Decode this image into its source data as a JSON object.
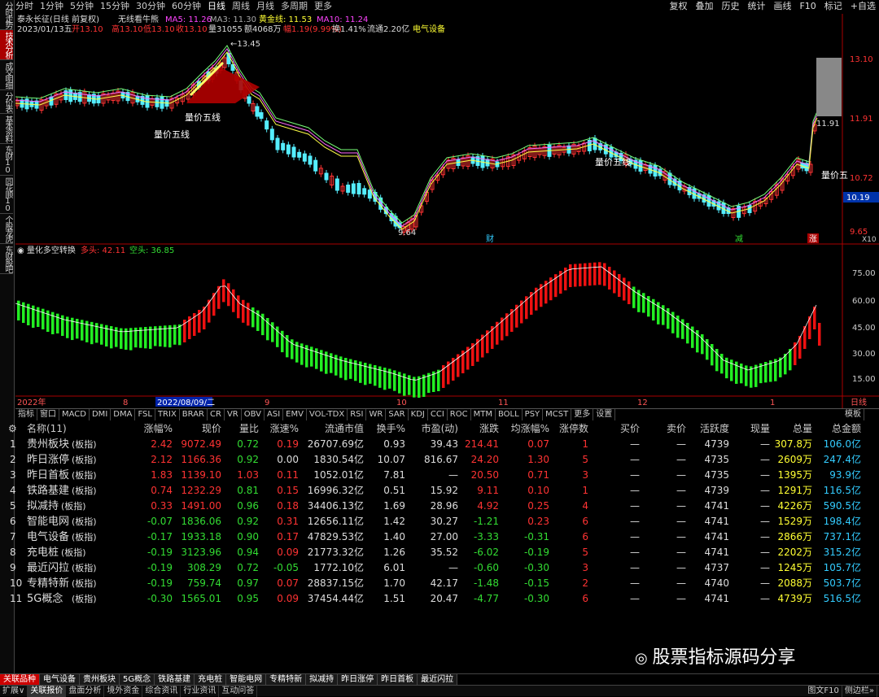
{
  "leftbar": [
    "分时走势",
    "技术分析",
    "成交明细",
    "分价表",
    "基本资料",
    "东财10",
    "同花顺10",
    "个股龙虎",
    "东财股吧"
  ],
  "toolbar": {
    "periods": [
      "分时",
      "1分钟",
      "5分钟",
      "15分钟",
      "30分钟",
      "60分钟",
      "日线",
      "周线",
      "月线",
      "多周期",
      "更多"
    ],
    "active": "日线",
    "right": [
      "复权",
      "叠加",
      "历史",
      "统计",
      "画线",
      "F10",
      "标记",
      "+自选"
    ]
  },
  "stock": {
    "title": "泰永长征(日线 前复权)",
    "indicator": "无线看牛熊",
    "ma5": "MA5: 11.26",
    "ma3": "MA3: 11.30",
    "gold": "黄金线: 11.53",
    "ma10": "MA10: 11.24",
    "info_date": "2023/01/13五",
    "info_open": "开13.10",
    "info_high": "高13.10",
    "info_low": "低13.10",
    "info_close": "收13.10",
    "info_vol": "量31055",
    "info_amt": "额4068万",
    "info_chg": "幅1.19(9.99%)",
    "info_turn": "换1.41%",
    "info_float": "流通2.20亿",
    "info_sector": "电气设备"
  },
  "price_axis": [
    "13.10",
    "11.91",
    "10.72",
    "9.65"
  ],
  "current_price": "10.19",
  "labels": {
    "high": "13.45",
    "low": "9.64",
    "lb1": "量价五线",
    "lb2": "量价五线",
    "lb3": "量价五线",
    "lb4": "量价五",
    "cur_hi": "11.91",
    "cai": "财",
    "jian": "减",
    "zhang": "涨",
    "x10": "X10"
  },
  "sub": {
    "title": "量化多空转换",
    "bull": "多头: 42.11",
    "bear": "空头: 36.85",
    "axis": [
      "75.00",
      "60.00",
      "45.00",
      "30.00",
      "15.00"
    ]
  },
  "dates": {
    "y2022": "2022年",
    "d8": "8",
    "sel": "2022/08/09/二",
    "d9": "9",
    "d10": "10",
    "d11": "11",
    "d12": "12",
    "d1": "1",
    "period": "日线"
  },
  "indicator_tabs": [
    "指标",
    "窗口",
    "MACD",
    "DMI",
    "DMA",
    "FSL",
    "TRIX",
    "BRAR",
    "CR",
    "VR",
    "OBV",
    "ASI",
    "EMV",
    "VOL-TDX",
    "RSI",
    "WR",
    "SAR",
    "KDJ",
    "CCI",
    "ROC",
    "MTM",
    "BOLL",
    "PSY",
    "MCST",
    "更多",
    "设置"
  ],
  "template_label": "模板",
  "table_headers": [
    "名称(11)",
    "涨幅%",
    "现价",
    "量比",
    "涨速%",
    "流通市值",
    "换手%",
    "市盈(动)",
    "涨跌",
    "均涨幅%",
    "涨停数",
    "买价",
    "卖价",
    "活跃度",
    "现量",
    "总量",
    "总金额"
  ],
  "rows": [
    [
      "1",
      "贵州板块",
      "(板指)",
      "2.42",
      "9072.49",
      "0.72",
      "0.19",
      "26707.69亿",
      "0.93",
      "39.43",
      "214.41",
      "0.07",
      "1",
      "—",
      "—",
      "4739",
      "—",
      "307.8万",
      "106.0亿"
    ],
    [
      "2",
      "昨日涨停",
      "(板指)",
      "2.12",
      "1166.36",
      "0.92",
      "0.00",
      "1830.54亿",
      "10.07",
      "816.67",
      "24.20",
      "1.30",
      "5",
      "—",
      "—",
      "4735",
      "—",
      "2609万",
      "247.4亿"
    ],
    [
      "3",
      "昨日首板",
      "(板指)",
      "1.83",
      "1139.10",
      "1.03",
      "0.11",
      "1052.01亿",
      "7.81",
      "—",
      "20.50",
      "0.71",
      "3",
      "—",
      "—",
      "4735",
      "—",
      "1395万",
      "93.9亿"
    ],
    [
      "4",
      "铁路基建",
      "(板指)",
      "0.74",
      "1232.29",
      "0.81",
      "0.15",
      "16996.32亿",
      "0.51",
      "15.92",
      "9.11",
      "0.10",
      "1",
      "—",
      "—",
      "4739",
      "—",
      "1291万",
      "116.5亿"
    ],
    [
      "5",
      "拟减持",
      "(板指)",
      "0.33",
      "1491.00",
      "0.96",
      "0.18",
      "34406.13亿",
      "1.69",
      "28.96",
      "4.92",
      "0.25",
      "4",
      "—",
      "—",
      "4741",
      "—",
      "4226万",
      "590.5亿"
    ],
    [
      "6",
      "智能电网",
      "(板指)",
      "-0.07",
      "1836.06",
      "0.92",
      "0.31",
      "12656.11亿",
      "1.42",
      "30.27",
      "-1.21",
      "0.23",
      "6",
      "—",
      "—",
      "4741",
      "—",
      "1529万",
      "198.4亿"
    ],
    [
      "7",
      "电气设备",
      "(板指)",
      "-0.17",
      "1933.18",
      "0.90",
      "0.17",
      "47829.53亿",
      "1.40",
      "27.00",
      "-3.33",
      "-0.31",
      "6",
      "—",
      "—",
      "4741",
      "—",
      "2866万",
      "737.1亿"
    ],
    [
      "8",
      "充电桩",
      "(板指)",
      "-0.19",
      "3123.96",
      "0.94",
      "0.09",
      "21773.32亿",
      "1.26",
      "35.52",
      "-6.02",
      "-0.19",
      "5",
      "—",
      "—",
      "4741",
      "—",
      "2202万",
      "315.2亿"
    ],
    [
      "9",
      "最近闪拉",
      "(板指)",
      "-0.19",
      "308.29",
      "0.72",
      "-0.05",
      "1772.10亿",
      "6.01",
      "—",
      "-0.60",
      "-0.30",
      "3",
      "—",
      "—",
      "4737",
      "—",
      "1245万",
      "105.7亿"
    ],
    [
      "10",
      "专精特新",
      "(板指)",
      "-0.19",
      "759.74",
      "0.97",
      "0.07",
      "28837.15亿",
      "1.70",
      "42.17",
      "-1.48",
      "-0.15",
      "2",
      "—",
      "—",
      "4740",
      "—",
      "2088万",
      "503.7亿"
    ],
    [
      "11",
      "5G概念",
      "(板指)",
      "-0.30",
      "1565.01",
      "0.95",
      "0.09",
      "37454.44亿",
      "1.51",
      "20.47",
      "-4.77",
      "-0.30",
      "6",
      "—",
      "—",
      "4741",
      "—",
      "4739万",
      "516.5亿"
    ]
  ],
  "bottom_tabs": [
    "关联品种",
    "电气设备",
    "贵州板块",
    "5G概念",
    "铁路基建",
    "充电桩",
    "智能电网",
    "专精特新",
    "拟减持",
    "昨日涨停",
    "昨日首板",
    "最近闪拉"
  ],
  "status_items": [
    "扩展∨",
    "关联报价",
    "盘面分析",
    "境外资金",
    "综合资讯",
    "行业资讯",
    "互动问答"
  ],
  "status_right": [
    "图文F10",
    "侧边栏»"
  ],
  "watermark": "股票指标源码分享",
  "colors": {
    "up": "#ff3333",
    "down": "#33dd33",
    "candle_down": "#55eeff"
  }
}
